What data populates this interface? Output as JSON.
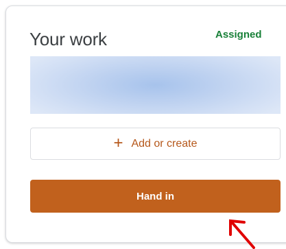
{
  "card": {
    "title": "Your work",
    "status": "Assigned"
  },
  "actions": {
    "add_label": "Add or create",
    "add_icon": "+",
    "hand_in_label": "Hand in"
  },
  "colors": {
    "status_green": "#188038",
    "accent_orange": "#c1611d",
    "add_text": "#b5571a",
    "arrow_red": "#e00000"
  },
  "annotation": {
    "icon": "red-arrow-icon"
  }
}
